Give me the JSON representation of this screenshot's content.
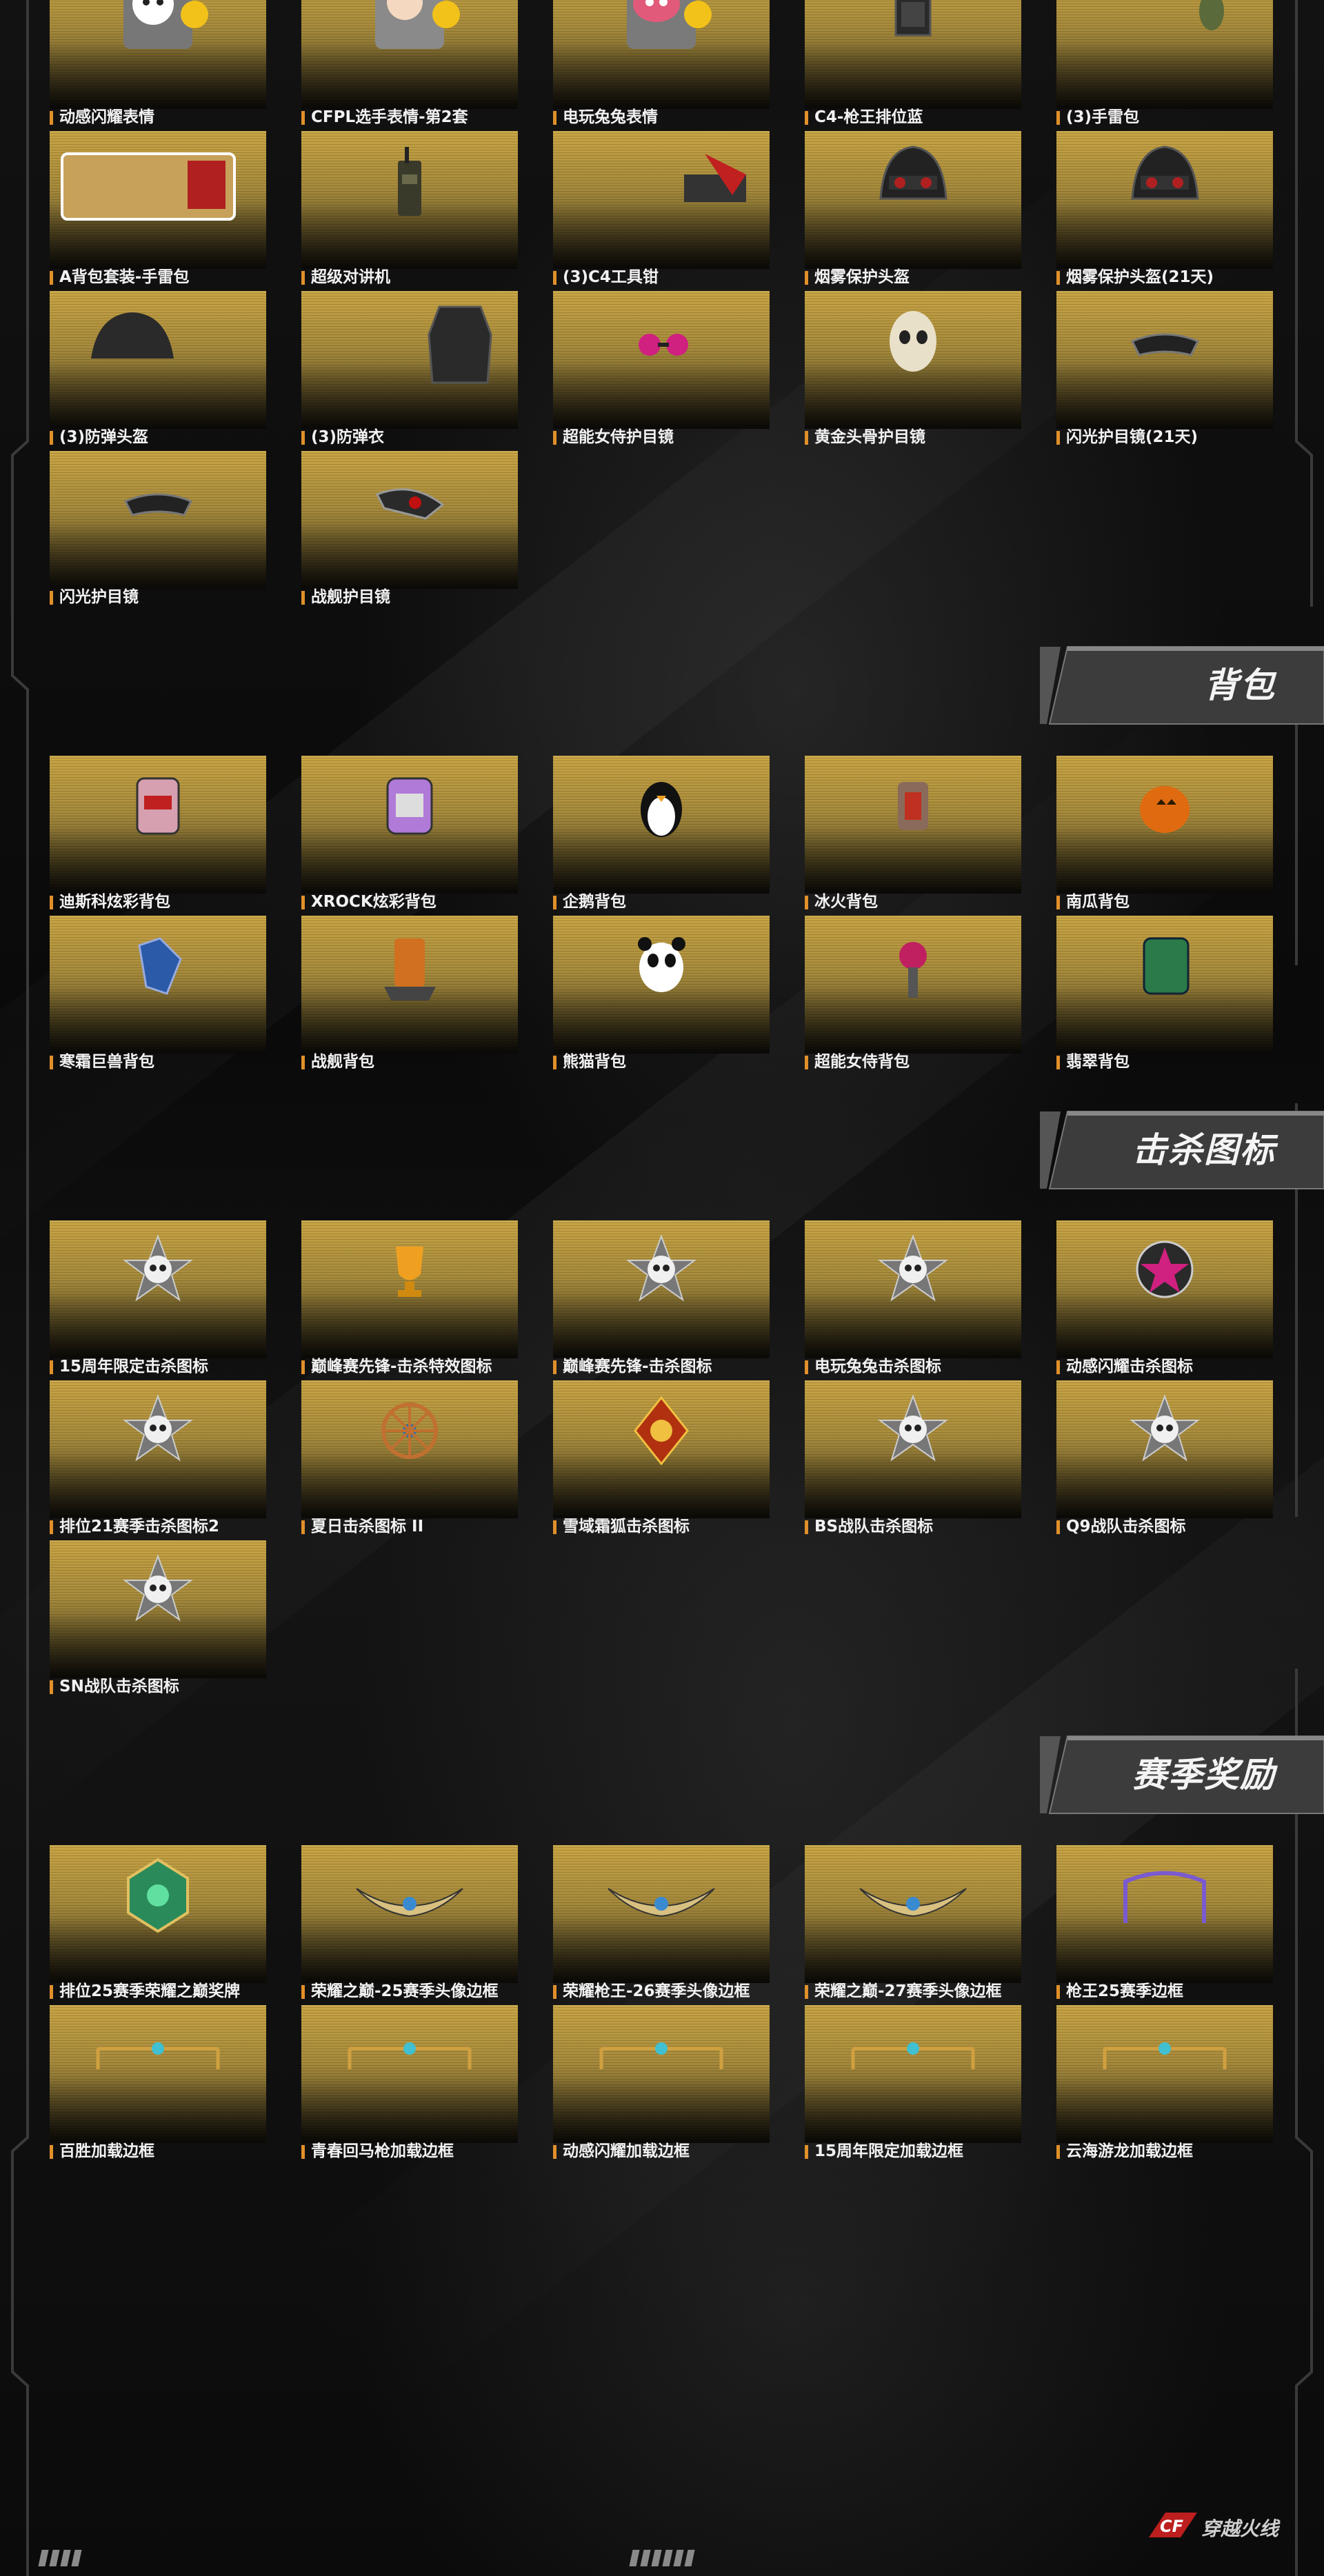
{
  "colors": {
    "card_gold": "#c8a444",
    "label_accent": "#e0902a",
    "background": "#0c0c0c",
    "banner": "#444444"
  },
  "sections": [
    {
      "title": "",
      "items": [
        {
          "label": "动感闪耀表情",
          "icon": "emoji-sticker-icon"
        },
        {
          "label": "CFPL选手表情-第2套",
          "icon": "player-emoji-icon"
        },
        {
          "label": "电玩兔兔表情",
          "icon": "bunny-emoji-icon"
        },
        {
          "label": "C4-枪王排位蓝",
          "icon": "c4-bomb-icon"
        },
        {
          "label": "(3)手雷包",
          "icon": "grenade-pack-icon"
        },
        {
          "label": "A背包套装-手雷包",
          "icon": "backpack-set-icon"
        },
        {
          "label": "超级对讲机",
          "icon": "walkie-talkie-icon"
        },
        {
          "label": "(3)C4工具钳",
          "icon": "c4-pliers-icon"
        },
        {
          "label": "烟雾保护头盔",
          "icon": "smoke-helmet-icon"
        },
        {
          "label": "烟雾保护头盔(21天)",
          "icon": "smoke-helmet-icon"
        },
        {
          "label": "(3)防弹头盔",
          "icon": "bulletproof-helmet-icon"
        },
        {
          "label": "(3)防弹衣",
          "icon": "bulletproof-vest-icon"
        },
        {
          "label": "超能女侍护目镜",
          "icon": "pink-goggles-icon"
        },
        {
          "label": "黄金头骨护目镜",
          "icon": "skull-mask-icon"
        },
        {
          "label": "闪光护目镜(21天)",
          "icon": "flash-goggles-icon"
        },
        {
          "label": "闪光护目镜",
          "icon": "flash-goggles-icon"
        },
        {
          "label": "战舰护目镜",
          "icon": "battleship-goggles-icon"
        }
      ]
    },
    {
      "title": "背包",
      "items": [
        {
          "label": "迪斯科炫彩背包",
          "icon": "disco-backpack-icon"
        },
        {
          "label": "XROCK炫彩背包",
          "icon": "xrock-backpack-icon"
        },
        {
          "label": "企鹅背包",
          "icon": "penguin-backpack-icon"
        },
        {
          "label": "冰火背包",
          "icon": "ice-fire-backpack-icon"
        },
        {
          "label": "南瓜背包",
          "icon": "pumpkin-backpack-icon"
        },
        {
          "label": "寒霜巨兽背包",
          "icon": "frost-beast-backpack-icon"
        },
        {
          "label": "战舰背包",
          "icon": "battleship-backpack-icon"
        },
        {
          "label": "熊猫背包",
          "icon": "panda-backpack-icon"
        },
        {
          "label": "超能女侍背包",
          "icon": "pink-backpack-icon"
        },
        {
          "label": "翡翠背包",
          "icon": "jade-backpack-icon"
        }
      ]
    },
    {
      "title": "击杀图标",
      "items": [
        {
          "label": "15周年限定击杀图标",
          "icon": "kill-skull-icon"
        },
        {
          "label": "巅峰赛先锋-击杀特效图标",
          "icon": "trophy-icon"
        },
        {
          "label": "巅峰赛先锋-击杀图标",
          "icon": "kill-skull-icon"
        },
        {
          "label": "电玩兔兔击杀图标",
          "icon": "kill-skull-icon"
        },
        {
          "label": "动感闪耀击杀图标",
          "icon": "star-badge-icon"
        },
        {
          "label": "排位21赛季击杀图标2",
          "icon": "kill-skull-icon"
        },
        {
          "label": "夏日击杀图标 II",
          "icon": "wheel-badge-icon"
        },
        {
          "label": "雪域霜狐击杀图标",
          "icon": "fox-badge-icon"
        },
        {
          "label": "BS战队击杀图标",
          "icon": "kill-skull-icon"
        },
        {
          "label": "Q9战队击杀图标",
          "icon": "kill-skull-icon"
        },
        {
          "label": "SN战队击杀图标",
          "icon": "kill-skull-icon"
        }
      ]
    },
    {
      "title": "赛季奖励",
      "items": [
        {
          "label": "排位25赛季荣耀之巅奖牌",
          "icon": "season-medal-icon"
        },
        {
          "label": "荣耀之巅-25赛季头像边框",
          "icon": "avatar-frame-icon"
        },
        {
          "label": "荣耀枪王-26赛季头像边框",
          "icon": "avatar-frame-icon"
        },
        {
          "label": "荣耀之巅-27赛季头像边框",
          "icon": "avatar-frame-icon"
        },
        {
          "label": "枪王25赛季边框",
          "icon": "border-frame-icon"
        },
        {
          "label": "百胜加载边框",
          "icon": "loading-frame-icon"
        },
        {
          "label": "青春回马枪加载边框",
          "icon": "loading-frame-icon"
        },
        {
          "label": "动感闪耀加载边框",
          "icon": "loading-frame-icon"
        },
        {
          "label": "15周年限定加载边框",
          "icon": "loading-frame-icon"
        },
        {
          "label": "云海游龙加载边框",
          "icon": "loading-frame-icon"
        }
      ]
    }
  ],
  "footer": {
    "logo_text": "穿越火线",
    "logo_mark": "CF"
  }
}
